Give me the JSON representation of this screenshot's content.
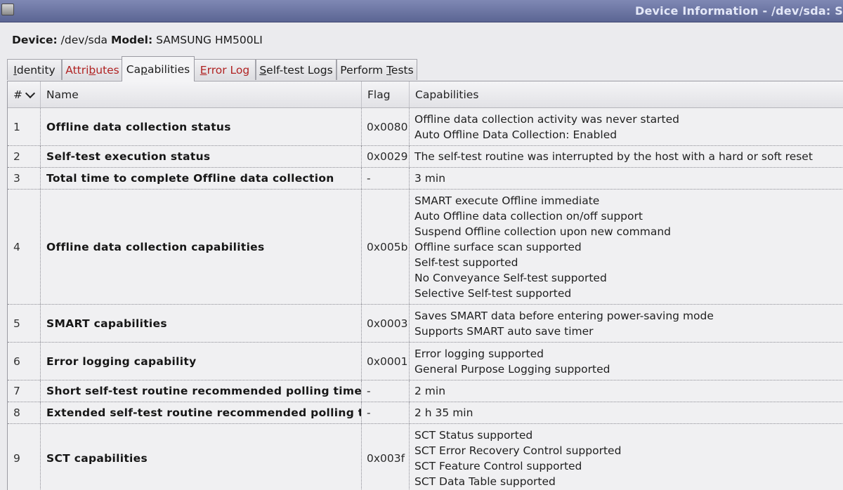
{
  "window": {
    "title": "Device Information - /dev/sda: S"
  },
  "device": {
    "device_label": "Device:",
    "device_value": "/dev/sda",
    "model_label": "Model:",
    "model_value": "SAMSUNG HM500LI"
  },
  "tabs": [
    {
      "pre": "",
      "ul": "I",
      "post": "dentity",
      "red": false,
      "active": false
    },
    {
      "pre": "Attri",
      "ul": "b",
      "post": "utes",
      "red": true,
      "active": false
    },
    {
      "pre": "Ca",
      "ul": "p",
      "post": "abilities",
      "red": false,
      "active": true
    },
    {
      "pre": "",
      "ul": "E",
      "post": "rror Log",
      "red": true,
      "active": false
    },
    {
      "pre": "",
      "ul": "S",
      "post": "elf-test Logs",
      "red": false,
      "active": false
    },
    {
      "pre": "Perform ",
      "ul": "T",
      "post": "ests",
      "red": false,
      "active": false
    }
  ],
  "table": {
    "headers": {
      "num": "#",
      "name": "Name",
      "flag": "Flag",
      "capabilities": "Capabilities"
    },
    "rows": [
      {
        "num": "1",
        "name": "Offline data collection status",
        "flag": "0x0080",
        "caps": [
          "Offline data collection activity was never started",
          "Auto Offline Data Collection: Enabled"
        ]
      },
      {
        "num": "2",
        "name": "Self-test execution status",
        "flag": "0x0029",
        "caps": [
          "The self-test routine was interrupted by the host with a hard or soft reset"
        ]
      },
      {
        "num": "3",
        "name": "Total time to complete Offline data collection",
        "flag": "-",
        "caps": [
          "3 min"
        ]
      },
      {
        "num": "4",
        "name": "Offline data collection capabilities",
        "flag": "0x005b",
        "caps": [
          "SMART execute Offline immediate",
          "Auto Offline data collection on/off support",
          "Suspend Offline collection upon new command",
          "Offline surface scan supported",
          "Self-test supported",
          "No Conveyance Self-test supported",
          "Selective Self-test supported"
        ]
      },
      {
        "num": "5",
        "name": "SMART capabilities",
        "flag": "0x0003",
        "caps": [
          "Saves SMART data before entering power-saving mode",
          "Supports SMART auto save timer"
        ]
      },
      {
        "num": "6",
        "name": "Error logging capability",
        "flag": "0x0001",
        "caps": [
          "Error logging supported",
          "General Purpose Logging supported"
        ]
      },
      {
        "num": "7",
        "name": "Short self-test routine recommended polling time",
        "flag": "-",
        "caps": [
          "2 min"
        ]
      },
      {
        "num": "8",
        "name": "Extended self-test routine recommended polling time",
        "flag": "-",
        "caps": [
          "2 h 35 min"
        ]
      },
      {
        "num": "9",
        "name": "SCT capabilities",
        "flag": "0x003f",
        "caps": [
          "SCT Status supported",
          "SCT Error Recovery Control supported",
          "SCT Feature Control supported",
          "SCT Data Table supported"
        ]
      }
    ]
  }
}
